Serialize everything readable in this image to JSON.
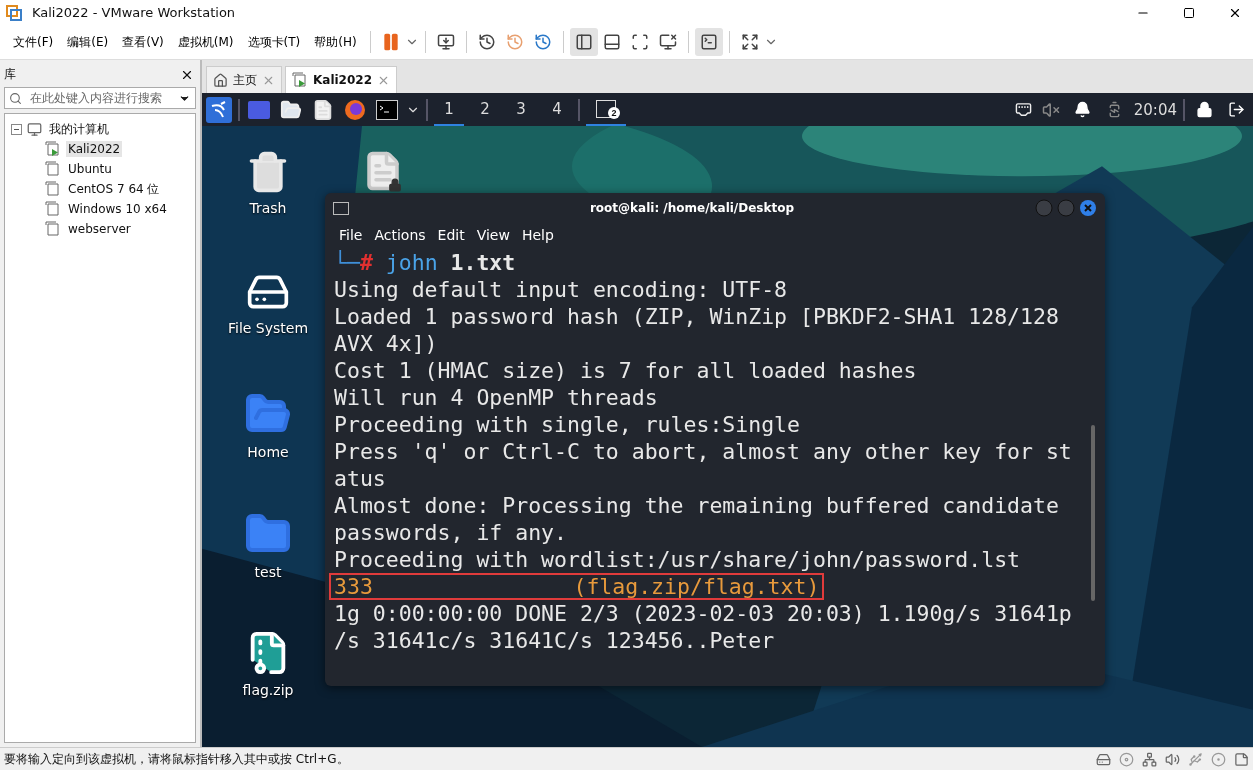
{
  "window": {
    "title": "Kali2022 - VMware Workstation"
  },
  "menu": [
    "文件(F)",
    "编辑(E)",
    "查看(V)",
    "虚拟机(M)",
    "选项卡(T)",
    "帮助(H)"
  ],
  "library": {
    "title": "库",
    "search": {
      "placeholder": "在此处键入内容进行搜索"
    },
    "tree": [
      {
        "label": "我的计算机",
        "expanded": true,
        "children": [
          {
            "label": "Kali2022",
            "selected": true,
            "running": true
          },
          {
            "label": "Ubuntu",
            "selected": false,
            "running": false
          },
          {
            "label": "CentOS 7 64 位",
            "selected": false,
            "running": false
          },
          {
            "label": "Windows 10 x64",
            "selected": false,
            "running": false
          },
          {
            "label": "webserver",
            "selected": false,
            "running": false
          }
        ]
      }
    ]
  },
  "tabs": [
    {
      "label": "主页",
      "kind": "home",
      "selected": false
    },
    {
      "label": "Kali2022",
      "kind": "vm",
      "selected": true
    }
  ],
  "vm": {
    "panel": {
      "workspaces": [
        {
          "label": "1",
          "selected": true
        },
        {
          "label": "2",
          "selected": false
        },
        {
          "label": "3",
          "selected": false
        },
        {
          "label": "4",
          "selected": false
        }
      ],
      "task_badge": "2",
      "clock": "20:04"
    },
    "desktop_icons": [
      {
        "label": "Trash",
        "kind": "trash"
      },
      {
        "label": "File System",
        "kind": "drive"
      },
      {
        "label": "Home",
        "kind": "home"
      },
      {
        "label": "test",
        "kind": "folder"
      },
      {
        "label": "flag.zip",
        "kind": "zip"
      }
    ],
    "terminal": {
      "title": "root@kali: /home/kali/Desktop",
      "menu": [
        "File",
        "Actions",
        "Edit",
        "View",
        "Help"
      ],
      "lines": [
        {
          "kind": "prompt",
          "prefix": "└─",
          "symbol": "#",
          "command": "john",
          "argument": "1.txt"
        },
        {
          "kind": "output",
          "text": "Using default input encoding: UTF-8"
        },
        {
          "kind": "output",
          "text": "Loaded 1 password hash (ZIP, WinZip [PBKDF2-SHA1 128/128"
        },
        {
          "kind": "output",
          "text": "AVX 4x])"
        },
        {
          "kind": "output",
          "text": "Cost 1 (HMAC size) is 7 for all loaded hashes"
        },
        {
          "kind": "output",
          "text": "Will run 4 OpenMP threads"
        },
        {
          "kind": "output",
          "text": "Proceeding with single, rules:Single"
        },
        {
          "kind": "output",
          "text": "Press 'q' or Ctrl-C to abort, almost any other key for st"
        },
        {
          "kind": "output",
          "text": "atus"
        },
        {
          "kind": "output",
          "text": "Almost done: Processing the remaining buffered candidate"
        },
        {
          "kind": "output",
          "text": "passwords, if any."
        },
        {
          "kind": "output",
          "text": "Proceeding with wordlist:/usr/share/john/password.lst"
        },
        {
          "kind": "found",
          "password": "333",
          "source": "(flag.zip/flag.txt)",
          "highlighted": true
        },
        {
          "kind": "output",
          "text": "1g 0:00:00:00 DONE 2/3 (2023-02-03 20:03) 1.190g/s 31641p"
        },
        {
          "kind": "output",
          "text": "/s 31641c/s 31641C/s 123456..Peter"
        }
      ]
    }
  },
  "status_bar": {
    "message": "要将输入定向到该虚拟机，请将鼠标指针移入其中或按 Ctrl+G。"
  }
}
